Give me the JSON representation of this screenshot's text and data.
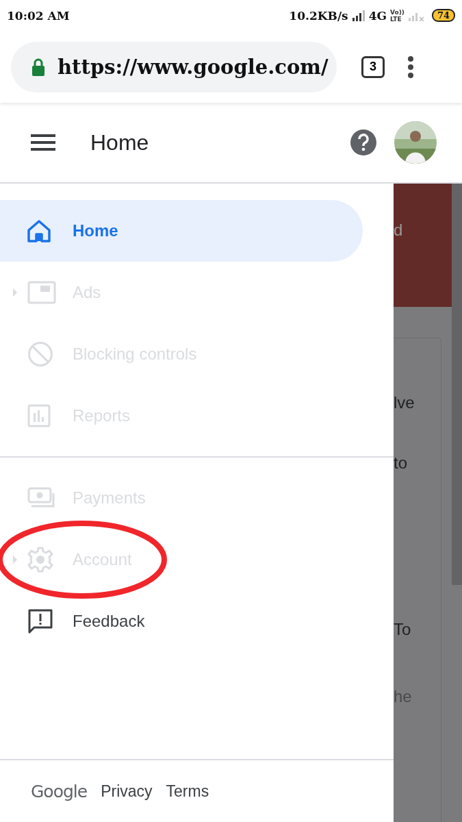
{
  "status_bar": {
    "time": "10:02 AM",
    "speed": "10.2KB/s",
    "network": "4G",
    "volte": [
      "Vo))",
      "LTE"
    ],
    "battery": "74"
  },
  "browser": {
    "url": "https://www.google.com/",
    "tab_count": "3"
  },
  "header": {
    "title": "Home"
  },
  "menu_sections": [
    [
      {
        "kind": "home",
        "label": "Home",
        "selected": true,
        "disabled": false,
        "expandable": false
      },
      {
        "kind": "ads",
        "label": "Ads",
        "selected": false,
        "disabled": true,
        "expandable": true
      },
      {
        "kind": "block",
        "label": "Blocking controls",
        "selected": false,
        "disabled": true,
        "expandable": false
      },
      {
        "kind": "reports",
        "label": "Reports",
        "selected": false,
        "disabled": true,
        "expandable": false
      }
    ],
    [
      {
        "kind": "payments",
        "label": "Payments",
        "selected": false,
        "disabled": true,
        "expandable": false
      },
      {
        "kind": "account",
        "label": "Account",
        "selected": false,
        "disabled": true,
        "expandable": true
      },
      {
        "kind": "feedback",
        "label": "Feedback",
        "selected": false,
        "disabled": false,
        "expandable": false
      }
    ]
  ],
  "footer": {
    "logo": "Google",
    "links": [
      "Privacy",
      "Terms"
    ]
  },
  "background_fragments": [
    "d",
    "lve",
    "to",
    "To",
    "he"
  ]
}
